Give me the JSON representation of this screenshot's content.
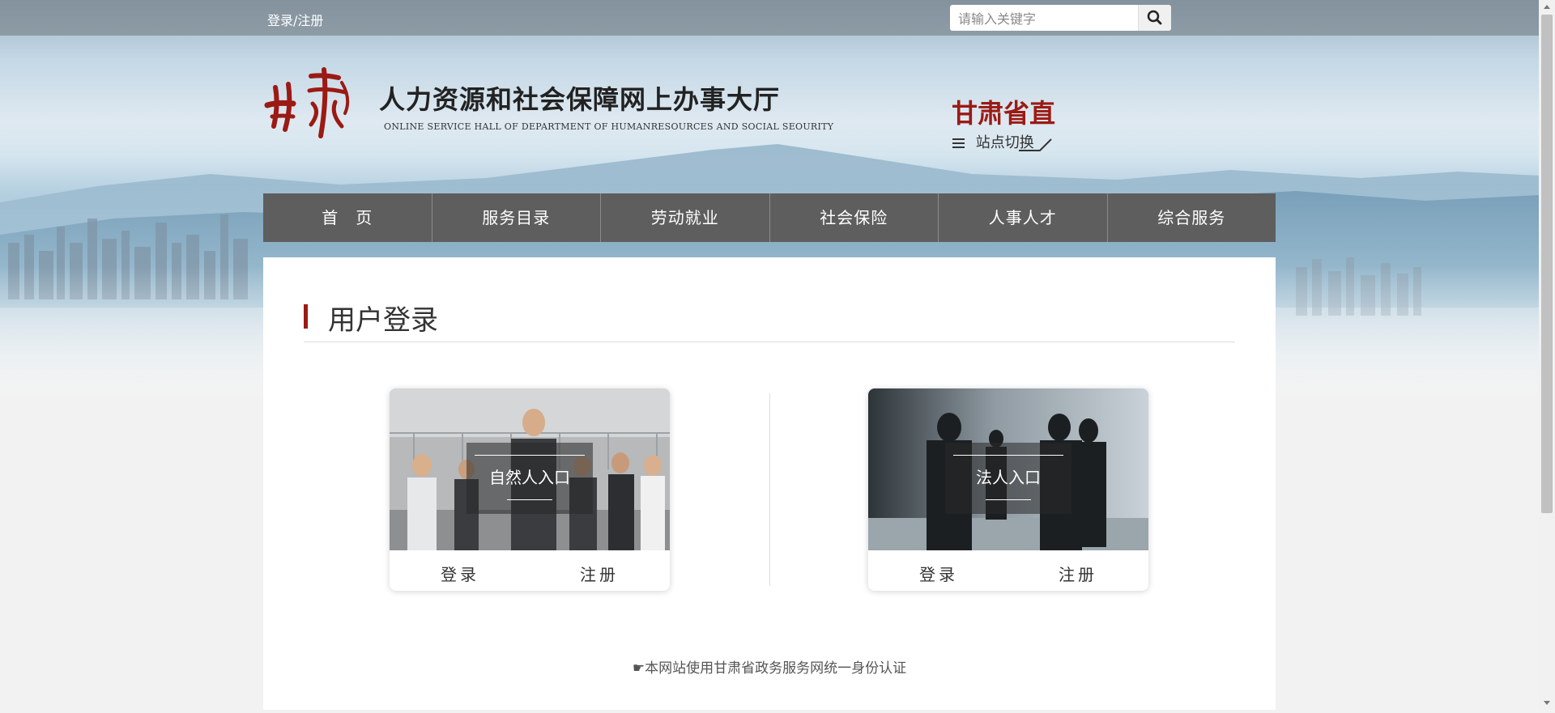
{
  "top_bar": {
    "login_register_label": "登录/注册",
    "search_placeholder": "请输入关键字"
  },
  "header": {
    "logo_text": "甘肃",
    "title": "人力资源和社会保障网上办事大厅",
    "subtitle": "ONLINE SERVICE HALL OF DEPARTMENT OF HUMANRESOURCES AND SOCIAL SEOURITY",
    "region_name": "甘肃省直",
    "site_switch_label": "站点切换"
  },
  "nav": {
    "items": [
      {
        "label": "首　页"
      },
      {
        "label": "服务目录"
      },
      {
        "label": "劳动就业"
      },
      {
        "label": "社会保险"
      },
      {
        "label": "人事人才"
      },
      {
        "label": "综合服务"
      }
    ]
  },
  "main": {
    "section_title": "用户登录",
    "cards": [
      {
        "label": "自然人入口",
        "login": "登录",
        "register": "注册"
      },
      {
        "label": "法人入口",
        "login": "登录",
        "register": "注册"
      }
    ],
    "footer_note": "☛本网站使用甘肃省政务服务网统一身份认证"
  },
  "colors": {
    "accent_red": "#9b1a14",
    "nav_bg": "#5e5e5e"
  },
  "icons": [
    "search-icon",
    "menu-icon",
    "pointing-hand-icon"
  ]
}
